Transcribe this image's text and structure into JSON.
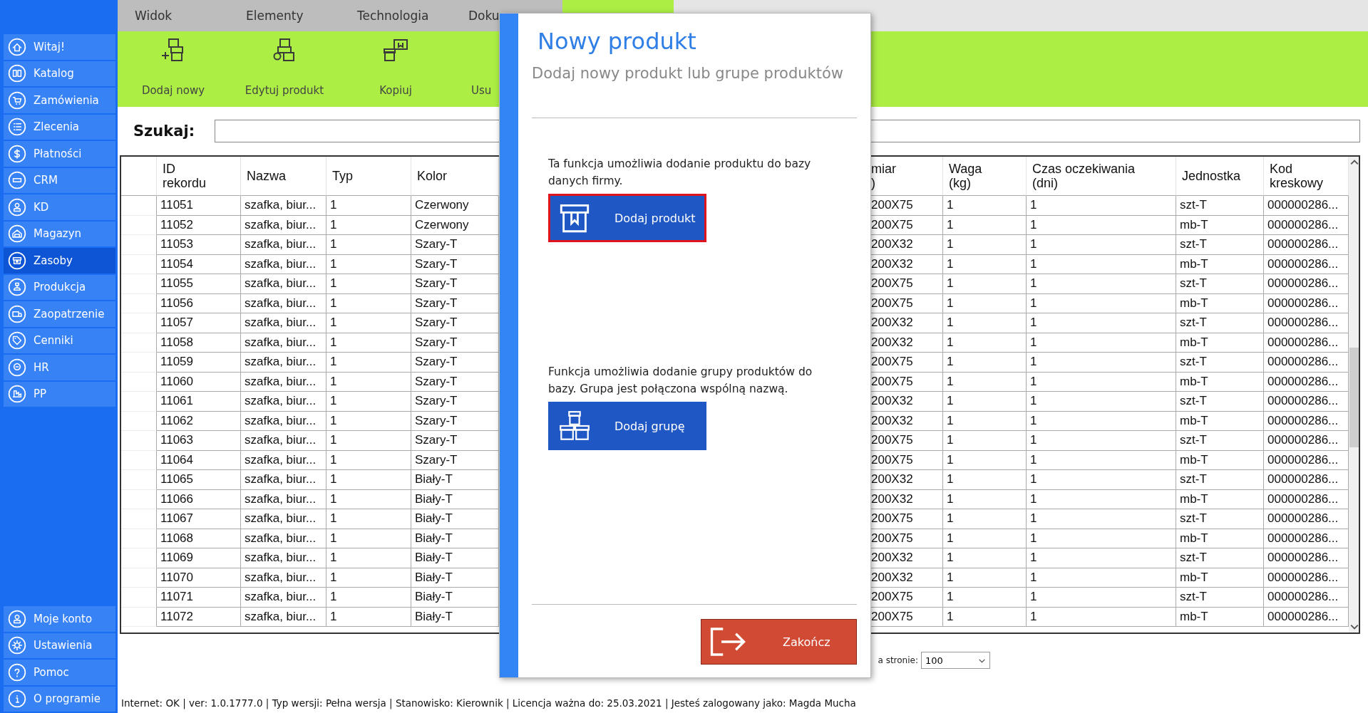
{
  "sidebar": {
    "items": [
      {
        "label": "Witaj!",
        "kind": "home",
        "selected": false
      },
      {
        "label": "Katalog",
        "kind": "book",
        "selected": false
      },
      {
        "label": "Zamówienia",
        "kind": "cart",
        "selected": false
      },
      {
        "label": "Zlecenia",
        "kind": "list",
        "selected": false
      },
      {
        "label": "Płatności",
        "kind": "dollar",
        "selected": false
      },
      {
        "label": "CRM",
        "kind": "crm",
        "selected": false
      },
      {
        "label": "KD",
        "kind": "person",
        "selected": false
      },
      {
        "label": "Magazyn",
        "kind": "warehouse",
        "selected": false
      },
      {
        "label": "Zasoby",
        "kind": "box",
        "selected": true
      },
      {
        "label": "Produkcja",
        "kind": "factory",
        "selected": false
      },
      {
        "label": "Zaopatrzenie",
        "kind": "truck",
        "selected": false
      },
      {
        "label": "Cenniki",
        "kind": "tag",
        "selected": false
      },
      {
        "label": "HR",
        "kind": "hr",
        "selected": false
      },
      {
        "label": "PP",
        "kind": "pp",
        "selected": false
      }
    ],
    "bottom_items": [
      {
        "label": "Moje konto",
        "kind": "user",
        "selected": false
      },
      {
        "label": "Ustawienia",
        "kind": "gear",
        "selected": false
      },
      {
        "label": "Pomoc",
        "kind": "help",
        "selected": false
      },
      {
        "label": "O programie",
        "kind": "info",
        "selected": false
      }
    ]
  },
  "tabs": [
    {
      "label": "Widok",
      "selected": false
    },
    {
      "label": "Elementy",
      "selected": false
    },
    {
      "label": "Technologia",
      "selected": false
    },
    {
      "label": "Doku",
      "selected": false
    },
    {
      "selected": true
    }
  ],
  "toolbar": {
    "buttons": [
      {
        "label": "Dodaj nowy",
        "kind": "add"
      },
      {
        "label": "Edytuj produkt",
        "kind": "edit"
      },
      {
        "label": "Kopiuj",
        "kind": "copy"
      },
      {
        "label": "Usu"
      }
    ]
  },
  "search": {
    "label": "Szukaj:"
  },
  "table": {
    "columns": [
      "ID\nrekordu",
      "Nazwa",
      "Typ",
      "Kolor",
      "miar\n)",
      "Waga\n(kg)",
      "Czas oczekiwania\n(dni)",
      "Jednostka",
      "Kod\nkreskowy"
    ],
    "rows": [
      [
        "11051",
        "szafka, biur...",
        "1",
        "Czerwony",
        "200X75",
        "1",
        "1",
        "szt-T",
        "000000286..."
      ],
      [
        "11052",
        "szafka, biur...",
        "1",
        "Czerwony",
        "200X75",
        "1",
        "1",
        "mb-T",
        "000000286..."
      ],
      [
        "11053",
        "szafka, biur...",
        "1",
        "Szary-T",
        "200X32",
        "1",
        "1",
        "szt-T",
        "000000286..."
      ],
      [
        "11054",
        "szafka, biur...",
        "1",
        "Szary-T",
        "200X32",
        "1",
        "1",
        "mb-T",
        "000000286..."
      ],
      [
        "11055",
        "szafka, biur...",
        "1",
        "Szary-T",
        "200X75",
        "1",
        "1",
        "szt-T",
        "000000286..."
      ],
      [
        "11056",
        "szafka, biur...",
        "1",
        "Szary-T",
        "200X75",
        "1",
        "1",
        "mb-T",
        "000000286..."
      ],
      [
        "11057",
        "szafka, biur...",
        "1",
        "Szary-T",
        "200X32",
        "1",
        "1",
        "szt-T",
        "000000286..."
      ],
      [
        "11058",
        "szafka, biur...",
        "1",
        "Szary-T",
        "200X32",
        "1",
        "1",
        "mb-T",
        "000000286..."
      ],
      [
        "11059",
        "szafka, biur...",
        "1",
        "Szary-T",
        "200X75",
        "1",
        "1",
        "szt-T",
        "000000286..."
      ],
      [
        "11060",
        "szafka, biur...",
        "1",
        "Szary-T",
        "200X75",
        "1",
        "1",
        "mb-T",
        "000000286..."
      ],
      [
        "11061",
        "szafka, biur...",
        "1",
        "Szary-T",
        "200X32",
        "1",
        "1",
        "szt-T",
        "000000286..."
      ],
      [
        "11062",
        "szafka, biur...",
        "1",
        "Szary-T",
        "200X32",
        "1",
        "1",
        "mb-T",
        "000000286..."
      ],
      [
        "11063",
        "szafka, biur...",
        "1",
        "Szary-T",
        "200X75",
        "1",
        "1",
        "szt-T",
        "000000286..."
      ],
      [
        "11064",
        "szafka, biur...",
        "1",
        "Szary-T",
        "200X75",
        "1",
        "1",
        "mb-T",
        "000000286..."
      ],
      [
        "11065",
        "szafka, biur...",
        "1",
        "Biały-T",
        "200X32",
        "1",
        "1",
        "szt-T",
        "000000286..."
      ],
      [
        "11066",
        "szafka, biur...",
        "1",
        "Biały-T",
        "200X32",
        "1",
        "1",
        "mb-T",
        "000000286..."
      ],
      [
        "11067",
        "szafka, biur...",
        "1",
        "Biały-T",
        "200X75",
        "1",
        "1",
        "szt-T",
        "000000286..."
      ],
      [
        "11068",
        "szafka, biur...",
        "1",
        "Biały-T",
        "200X75",
        "1",
        "1",
        "mb-T",
        "000000286..."
      ],
      [
        "11069",
        "szafka, biur...",
        "1",
        "Biały-T",
        "200X32",
        "1",
        "1",
        "szt-T",
        "000000286..."
      ],
      [
        "11070",
        "szafka, biur...",
        "1",
        "Biały-T",
        "200X32",
        "1",
        "1",
        "mb-T",
        "000000286..."
      ],
      [
        "11071",
        "szafka, biur...",
        "1",
        "Biały-T",
        "200X75",
        "1",
        "1",
        "szt-T",
        "000000286..."
      ],
      [
        "11072",
        "szafka, biur...",
        "1",
        "Biały-T",
        "200X75",
        "1",
        "1",
        "mb-T",
        "000000286..."
      ]
    ]
  },
  "pagination": {
    "label": "a stronie:",
    "value": "100"
  },
  "status_bar": "Internet: OK  |  ver: 1.0.1777.0  |  Typ wersji: Pełna wersja  |  Stanowisko: Kierownik  |  Licencja ważna do: 25.03.2021  |  Jesteś zalogowany jako: Magda Mucha",
  "dialog": {
    "title": "Nowy produkt",
    "subtitle": "Dodaj nowy produkt lub grupe produktów",
    "options": [
      {
        "description": "Ta funkcja umożliwia dodanie produktu do bazy danych firmy.",
        "button": "Dodaj produkt",
        "kind": "single",
        "focused": true
      },
      {
        "description": "Funkcja umożliwia dodanie grupy produktów do bazy. Grupa jest połączona wspólną nazwą.",
        "button": "Dodaj grupę",
        "kind": "group",
        "focused": false
      }
    ],
    "close_button": "Zakończ"
  }
}
